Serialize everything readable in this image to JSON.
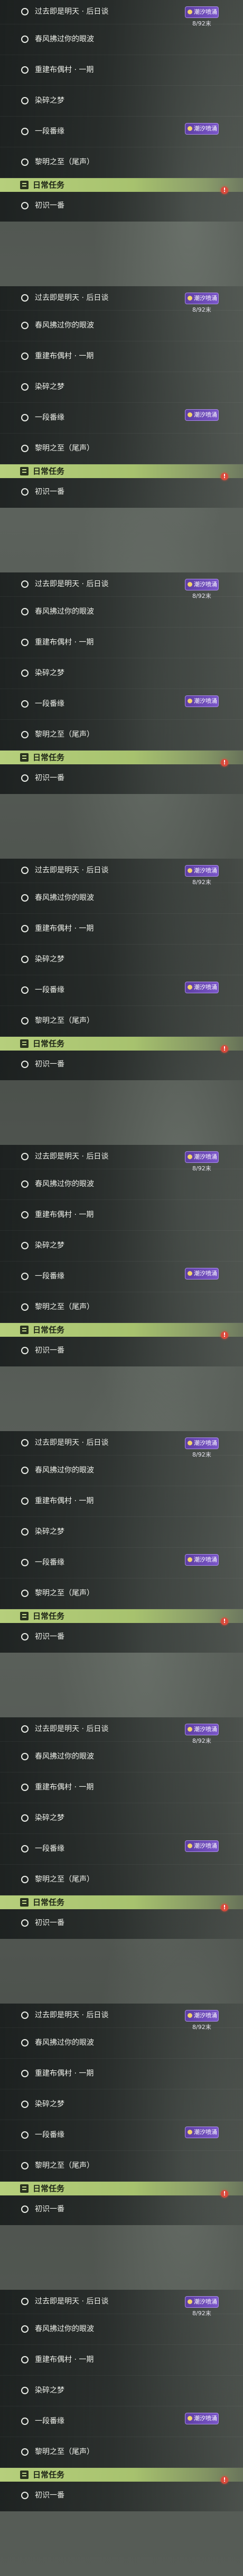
{
  "quests": [
    "过去即是明天 · 后日谈",
    "春风拂过你的眼波",
    "重建布偶村 · 一期",
    "染碎之梦",
    "一段番缘",
    "黎明之至（尾声）"
  ],
  "reward": {
    "badge": "潮汐喷涌",
    "sub": "8/92末"
  },
  "daily": {
    "header": "日常任务",
    "item": "初识一番"
  },
  "colors": {
    "section_header": "#b6cf7c",
    "reward_badge": "#6a48b5",
    "alert": "#d84a3c"
  }
}
